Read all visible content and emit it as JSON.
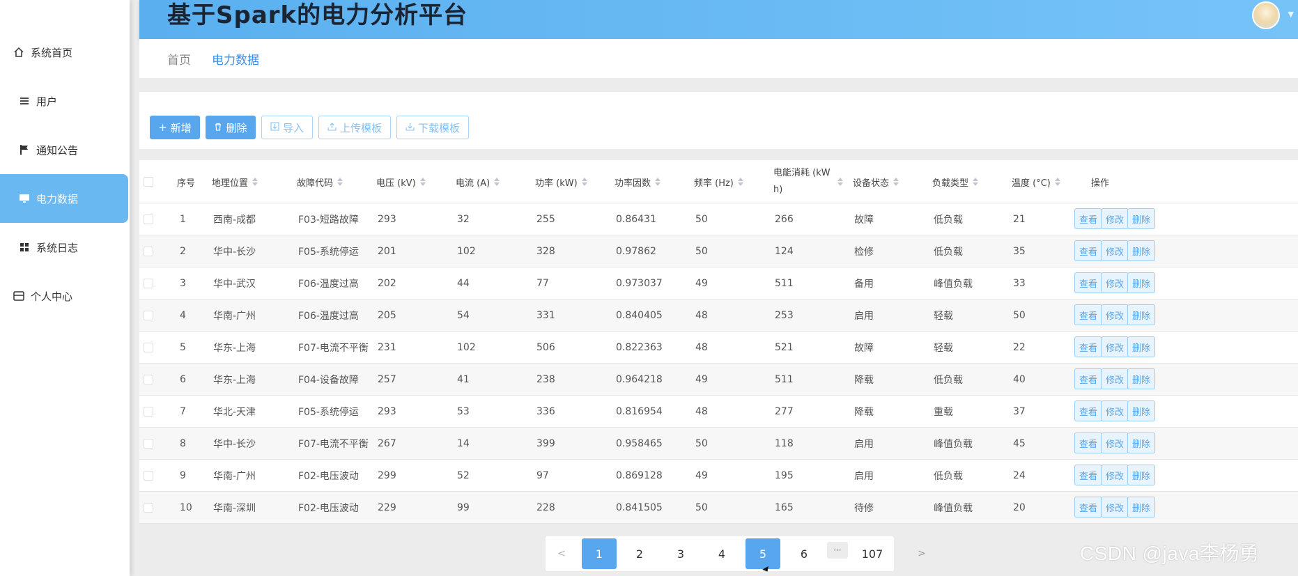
{
  "app": {
    "title": "基于Spark的电力分析平台"
  },
  "sidebar": {
    "items": [
      {
        "label": "系统首页",
        "icon": "home-icon",
        "active": false
      },
      {
        "label": "用户",
        "icon": "menu-icon",
        "active": false
      },
      {
        "label": "通知公告",
        "icon": "flag-icon",
        "active": false
      },
      {
        "label": "电力数据",
        "icon": "monitor-icon",
        "active": true
      },
      {
        "label": "系统日志",
        "icon": "grid-icon",
        "active": false
      },
      {
        "label": "个人中心",
        "icon": "profile-icon",
        "active": false
      }
    ]
  },
  "breadcrumb": {
    "home": "首页",
    "current": "电力数据"
  },
  "toolbar": {
    "add_label": "新增",
    "delete_label": "删除",
    "import_label": "导入",
    "upload_template_label": "上传模板",
    "download_template_label": "下载模板"
  },
  "table": {
    "headers": [
      "序号",
      "地理位置",
      "故障代码",
      "电压 (kV)",
      "电流 (A)",
      "功率 (kW)",
      "功率因数",
      "频率 (Hz)",
      "电能消耗 (kW h)",
      "设备状态",
      "负载类型",
      "温度 (°C)",
      "操作"
    ],
    "rows": [
      [
        "1",
        "西南-成都",
        "F03-短路故障",
        "293",
        "32",
        "255",
        "0.86431",
        "50",
        "266",
        "故障",
        "低负载",
        "21"
      ],
      [
        "2",
        "华中-长沙",
        "F05-系统停运",
        "201",
        "102",
        "328",
        "0.97862",
        "50",
        "124",
        "检修",
        "低负载",
        "35"
      ],
      [
        "3",
        "华中-武汉",
        "F06-温度过高",
        "202",
        "44",
        "77",
        "0.973037",
        "49",
        "511",
        "备用",
        "峰值负载",
        "33"
      ],
      [
        "4",
        "华南-广州",
        "F06-温度过高",
        "205",
        "54",
        "331",
        "0.840405",
        "48",
        "253",
        "启用",
        "轻载",
        "50"
      ],
      [
        "5",
        "华东-上海",
        "F07-电流不平衡",
        "231",
        "102",
        "506",
        "0.822363",
        "48",
        "521",
        "故障",
        "轻载",
        "22"
      ],
      [
        "6",
        "华东-上海",
        "F04-设备故障",
        "257",
        "41",
        "238",
        "0.964218",
        "49",
        "511",
        "降载",
        "低负载",
        "40"
      ],
      [
        "7",
        "华北-天津",
        "F05-系统停运",
        "293",
        "53",
        "336",
        "0.816954",
        "48",
        "277",
        "降载",
        "重载",
        "37"
      ],
      [
        "8",
        "华中-长沙",
        "F07-电流不平衡",
        "267",
        "14",
        "399",
        "0.958465",
        "50",
        "118",
        "启用",
        "峰值负载",
        "45"
      ],
      [
        "9",
        "华南-广州",
        "F02-电压波动",
        "299",
        "52",
        "97",
        "0.869128",
        "49",
        "195",
        "启用",
        "低负载",
        "24"
      ],
      [
        "10",
        "华南-深圳",
        "F02-电压波动",
        "229",
        "99",
        "228",
        "0.841505",
        "50",
        "165",
        "待修",
        "峰值负载",
        "20"
      ]
    ],
    "row_actions": {
      "view": "查看",
      "edit": "修改",
      "delete": "删除"
    }
  },
  "pagination": {
    "prev": "<",
    "pages": [
      "1",
      "2",
      "3",
      "4",
      "5",
      "6"
    ],
    "ellipsis": "···",
    "last": "107",
    "next": ">",
    "current": "1"
  },
  "watermark": "CSDN @java李杨勇",
  "colors": {
    "accent": "#58a7ee",
    "header_start": "#5ab0ef",
    "header_end": "#76c3f8",
    "active_nav": "#6ab8f2"
  }
}
